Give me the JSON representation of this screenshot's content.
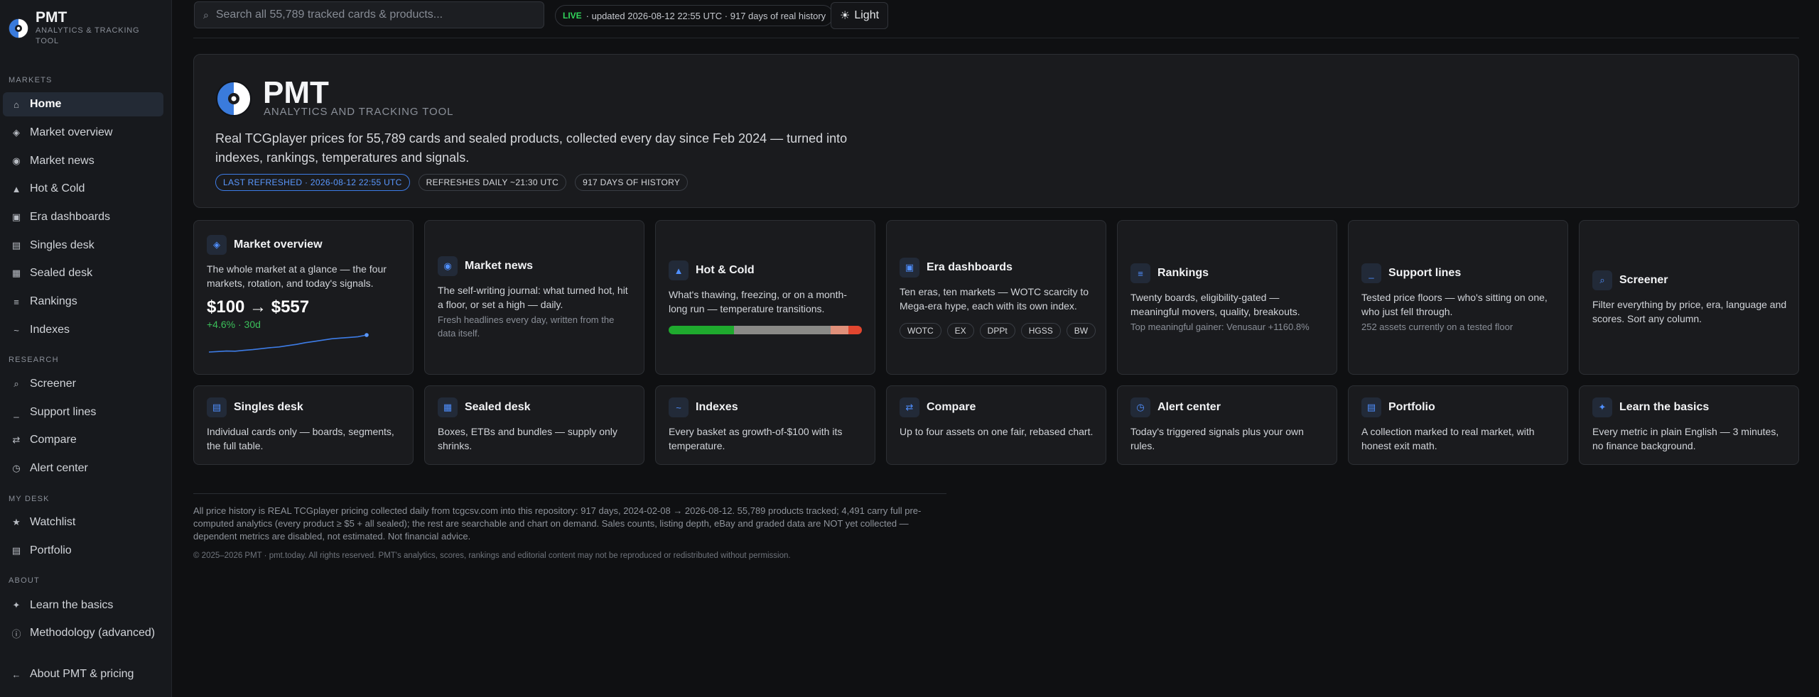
{
  "brand": {
    "name": "PMT",
    "subtitle": "Analytics & tracking tool"
  },
  "sidebar": {
    "sections": {
      "markets": "Markets",
      "research": "Research",
      "my_desk": "My desk",
      "about": "About"
    },
    "items": [
      {
        "label": "Home",
        "icon": "home-icon",
        "active": true
      },
      {
        "label": "Market overview",
        "icon": "diamond-icon"
      },
      {
        "label": "Market news",
        "icon": "radio-icon"
      },
      {
        "label": "Hot & Cold",
        "icon": "flame-icon"
      },
      {
        "label": "Era dashboards",
        "icon": "dashboard-icon"
      },
      {
        "label": "Singles desk",
        "icon": "card-icon"
      },
      {
        "label": "Sealed desk",
        "icon": "box-icon"
      },
      {
        "label": "Rankings",
        "icon": "list-icon"
      },
      {
        "label": "Indexes",
        "icon": "wave-icon"
      },
      {
        "label": "Screener",
        "icon": "search-icon"
      },
      {
        "label": "Support lines",
        "icon": "underline-icon"
      },
      {
        "label": "Compare",
        "icon": "swap-icon"
      },
      {
        "label": "Alert center",
        "icon": "clock-icon"
      },
      {
        "label": "Watchlist",
        "icon": "star-icon"
      },
      {
        "label": "Portfolio",
        "icon": "folder-icon"
      },
      {
        "label": "Learn the basics",
        "icon": "sparkle-icon"
      },
      {
        "label": "Methodology (advanced)",
        "icon": "info-icon"
      },
      {
        "label": "About PMT & pricing",
        "icon": "arrow-left-icon"
      }
    ]
  },
  "topbar": {
    "search_placeholder": "Search all 55,789 tracked cards & products...",
    "live_tag": "LIVE",
    "live_text": "· updated 2026-08-12 22:55 UTC · 917 days of real history",
    "theme_label": "Light"
  },
  "hero": {
    "title": "PMT",
    "subtitle": "Analytics and tracking tool",
    "description": "Real TCGplayer prices for 55,789 cards and sealed products, collected every day since Feb 2024 — turned into indexes, rankings, temperatures and signals.",
    "pills": [
      "Last refreshed · 2026-08-12 22:55 UTC",
      "Refreshes daily ~21:30 UTC",
      "917 days of history"
    ]
  },
  "cards": {
    "market_overview": {
      "title": "Market overview",
      "desc": "The whole market at a glance — the four markets, rotation, and today's signals.",
      "value": "$100 → $557",
      "delta": "+4.6% · 30d",
      "sparkline": [
        0.0,
        0.03,
        0.06,
        0.05,
        0.1,
        0.14,
        0.2,
        0.26,
        0.3,
        0.38,
        0.45,
        0.55,
        0.62,
        0.7,
        0.78,
        0.82,
        0.86,
        0.9,
        1.0
      ]
    },
    "market_news": {
      "title": "Market news",
      "desc": "The self-writing journal: what turned hot, hit a floor, or set a high — daily.",
      "muted": "Fresh headlines every day, written from the data itself."
    },
    "hot_cold": {
      "title": "Hot & Cold",
      "desc": "What's thawing, freezing, or on a month-long run — temperature transitions.",
      "bar": [
        {
          "share": 0.34,
          "color": "#1faa2e"
        },
        {
          "share": 0.5,
          "color": "#8a8a87"
        },
        {
          "share": 0.09,
          "color": "#e0907a"
        },
        {
          "share": 0.07,
          "color": "#e2462f"
        }
      ]
    },
    "era_dashboards": {
      "title": "Era dashboards",
      "desc": "Ten eras, ten markets — WOTC scarcity to Mega-era hype, each with its own index.",
      "tags": [
        "WOTC",
        "EX",
        "DPPt",
        "HGSS",
        "BW"
      ]
    },
    "rankings": {
      "title": "Rankings",
      "desc": "Twenty boards, eligibility-gated — meaningful movers, quality, breakouts.",
      "muted": "Top meaningful gainer: Venusaur +1160.8%"
    },
    "support_lines": {
      "title": "Support lines",
      "desc": "Tested price floors — who's sitting on one, who just fell through.",
      "muted": "252 assets currently on a tested floor"
    },
    "screener": {
      "title": "Screener",
      "desc": "Filter everything by price, era, language and scores. Sort any column."
    },
    "singles_desk": {
      "title": "Singles desk",
      "desc": "Individual cards only — boards, segments, the full table."
    },
    "sealed_desk": {
      "title": "Sealed desk",
      "desc": "Boxes, ETBs and bundles — supply only shrinks."
    },
    "indexes": {
      "title": "Indexes",
      "desc": "Every basket as growth-of-$100 with its temperature."
    },
    "compare": {
      "title": "Compare",
      "desc": "Up to four assets on one fair, rebased chart."
    },
    "alert_center": {
      "title": "Alert center",
      "desc": "Today's triggered signals plus your own rules."
    },
    "portfolio": {
      "title": "Portfolio",
      "desc": "A collection marked to real market, with honest exit math."
    },
    "learn_basics": {
      "title": "Learn the basics",
      "desc": "Every metric in plain English — 3 minutes, no finance background."
    }
  },
  "footer": {
    "note": "All price history is REAL TCGplayer pricing collected daily from tcgcsv.com into this repository: 917 days, 2024-02-08 → 2026-08-12. 55,789 products tracked; 4,491 carry full pre-computed analytics (every product ≥ $5 + all sealed); the rest are searchable and chart on demand. Sales counts, listing depth, eBay and graded data are NOT yet collected — dependent metrics are disabled, not estimated. Not financial advice.",
    "copyright": "© 2025–2026 PMT · pmt.today. All rights reserved. PMT's analytics, scores, rankings and editorial content may not be reproduced or redistributed without permission."
  },
  "colors": {
    "accent": "#4f8fff",
    "live_green": "#31d45a",
    "positive": "#3bbf5a",
    "background": "#0f1012",
    "card": "#1a1b1e"
  }
}
